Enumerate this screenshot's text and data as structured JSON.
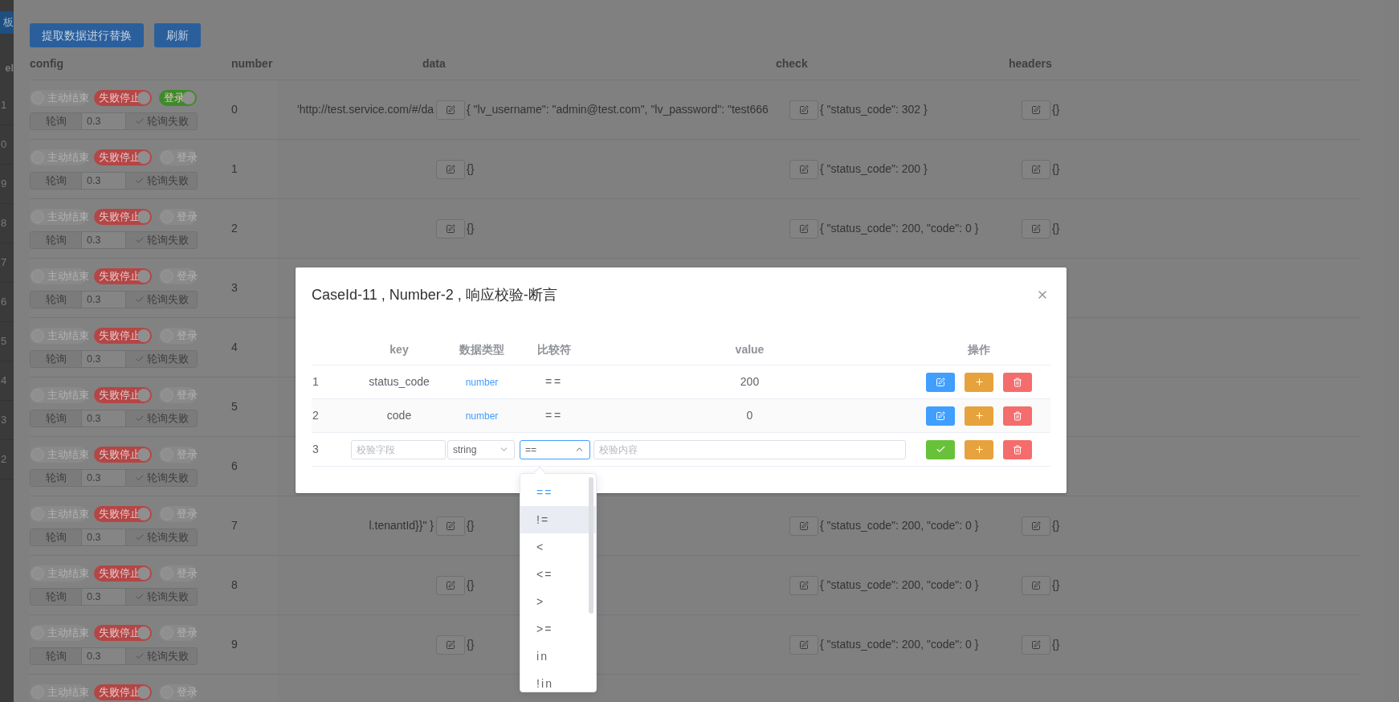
{
  "left_panel": {
    "tab": "板",
    "header": "el",
    "row_numbers": [
      "1",
      "0",
      "9",
      "8",
      "7",
      "6",
      "5",
      "4",
      "3",
      "2"
    ]
  },
  "toolbar": {
    "buttons": [
      "提取数据进行替换",
      "刷新"
    ]
  },
  "table": {
    "columns": [
      "config",
      "number",
      "data",
      "check",
      "headers"
    ],
    "rows": [
      {
        "switches": [
          {
            "kind": "end",
            "label": "主动结束",
            "on": false
          },
          {
            "kind": "stop",
            "label": "失败停止",
            "on": true
          },
          {
            "kind": "login",
            "label": "登录",
            "on": true
          }
        ],
        "poll": {
          "label": "轮询",
          "value": "0.3",
          "fail_label": "轮询失败",
          "checked": true
        },
        "number": "0",
        "url": "'http://test.service.com/#/da",
        "data": "{ \"lv_username\": \"admin@test.com\", \"lv_password\": \"test666",
        "check": "{ \"status_code\": 302 }",
        "headers": "{}"
      },
      {
        "switches": [
          {
            "kind": "end",
            "label": "主动结束",
            "on": false
          },
          {
            "kind": "stop",
            "label": "失败停止",
            "on": true
          },
          {
            "kind": "login",
            "label": "登录",
            "on": false
          }
        ],
        "poll": {
          "label": "轮询",
          "value": "0.3",
          "fail_label": "轮询失败",
          "checked": true
        },
        "number": "1",
        "data": "{}",
        "check": "{ \"status_code\": 200 }",
        "headers": "{}"
      },
      {
        "switches": [
          {
            "kind": "end",
            "label": "主动结束",
            "on": false
          },
          {
            "kind": "stop",
            "label": "失败停止",
            "on": true
          },
          {
            "kind": "login",
            "label": "登录",
            "on": false
          }
        ],
        "poll": {
          "label": "轮询",
          "value": "0.3",
          "fail_label": "轮询失败",
          "checked": true
        },
        "number": "2",
        "data": "{}",
        "check": "{ \"status_code\": 200, \"code\": 0 }",
        "headers": "{}"
      },
      {
        "switches": [
          {
            "kind": "end",
            "label": "主动结束",
            "on": false
          },
          {
            "kind": "stop",
            "label": "失败停止",
            "on": true
          },
          {
            "kind": "login",
            "label": "登录",
            "on": false
          }
        ],
        "poll": {
          "label": "轮询",
          "value": "0.3",
          "fail_label": "轮询失败",
          "checked": true
        },
        "number": "3"
      },
      {
        "switches": [
          {
            "kind": "end",
            "label": "主动结束",
            "on": false
          },
          {
            "kind": "stop",
            "label": "失败停止",
            "on": true
          },
          {
            "kind": "login",
            "label": "登录",
            "on": false
          }
        ],
        "poll": {
          "label": "轮询",
          "value": "0.3",
          "fail_label": "轮询失败",
          "checked": true
        },
        "number": "4"
      },
      {
        "switches": [
          {
            "kind": "end",
            "label": "主动结束",
            "on": false
          },
          {
            "kind": "stop",
            "label": "失败停止",
            "on": true
          },
          {
            "kind": "login",
            "label": "登录",
            "on": false
          }
        ],
        "poll": {
          "label": "轮询",
          "value": "0.3",
          "fail_label": "轮询失败",
          "checked": true
        },
        "number": "5"
      },
      {
        "switches": [
          {
            "kind": "end",
            "label": "主动结束",
            "on": false
          },
          {
            "kind": "stop",
            "label": "失败停止",
            "on": true
          },
          {
            "kind": "login",
            "label": "登录",
            "on": false
          }
        ],
        "poll": {
          "label": "轮询",
          "value": "0.3",
          "fail_label": "轮询失败",
          "checked": true
        },
        "number": "6"
      },
      {
        "switches": [
          {
            "kind": "end",
            "label": "主动结束",
            "on": false
          },
          {
            "kind": "stop",
            "label": "失败停止",
            "on": true
          },
          {
            "kind": "login",
            "label": "登录",
            "on": false
          }
        ],
        "poll": {
          "label": "轮询",
          "value": "0.3",
          "fail_label": "轮询失败",
          "checked": true
        },
        "number": "7",
        "url": "l.tenantId}}\" }",
        "data": "{}",
        "check": "{ \"status_code\": 200, \"code\": 0 }",
        "headers": "{}"
      },
      {
        "switches": [
          {
            "kind": "end",
            "label": "主动结束",
            "on": false
          },
          {
            "kind": "stop",
            "label": "失败停止",
            "on": true
          },
          {
            "kind": "login",
            "label": "登录",
            "on": false
          }
        ],
        "poll": {
          "label": "轮询",
          "value": "0.3",
          "fail_label": "轮询失败",
          "checked": true
        },
        "number": "8",
        "data": "{}",
        "check": "{ \"status_code\": 200, \"code\": 0 }",
        "headers": "{}"
      },
      {
        "switches": [
          {
            "kind": "end",
            "label": "主动结束",
            "on": false
          },
          {
            "kind": "stop",
            "label": "失败停止",
            "on": true
          },
          {
            "kind": "login",
            "label": "登录",
            "on": false
          }
        ],
        "poll": {
          "label": "轮询",
          "value": "0.3",
          "fail_label": "轮询失败",
          "checked": true
        },
        "number": "9",
        "data": "{}",
        "check": "{ \"status_code\": 200, \"code\": 0 }",
        "headers": "{}"
      },
      {
        "switches": [
          {
            "kind": "end",
            "label": "主动结束",
            "on": false
          },
          {
            "kind": "stop",
            "label": "失败停止",
            "on": true
          },
          {
            "kind": "login",
            "label": "登录",
            "on": false
          }
        ]
      }
    ]
  },
  "dialog": {
    "title": "CaseId-11 , Number-2 , 响应校验-断言",
    "columns": [
      "key",
      "数据类型",
      "比较符",
      "value",
      "操作"
    ],
    "rows": [
      {
        "kind": "view",
        "index": "1",
        "key": "status_code",
        "type": "number",
        "operator": "==",
        "value": "200"
      },
      {
        "kind": "view",
        "index": "2",
        "key": "code",
        "type": "number",
        "operator": "==",
        "value": "0"
      },
      {
        "kind": "edit",
        "index": "3",
        "key_placeholder": "校验字段",
        "type": "string",
        "operator": "==",
        "value_placeholder": "校验内容"
      }
    ],
    "operator_menu": {
      "options": [
        {
          "label": "==",
          "selected": true,
          "hovered": false
        },
        {
          "label": "!=",
          "selected": false,
          "hovered": true
        },
        {
          "label": "<",
          "selected": false,
          "hovered": false
        },
        {
          "label": "<=",
          "selected": false,
          "hovered": false
        },
        {
          "label": ">",
          "selected": false,
          "hovered": false
        },
        {
          "label": ">=",
          "selected": false,
          "hovered": false
        },
        {
          "label": "in",
          "selected": false,
          "hovered": false
        },
        {
          "label": "!in",
          "selected": false,
          "hovered": false
        }
      ]
    }
  }
}
